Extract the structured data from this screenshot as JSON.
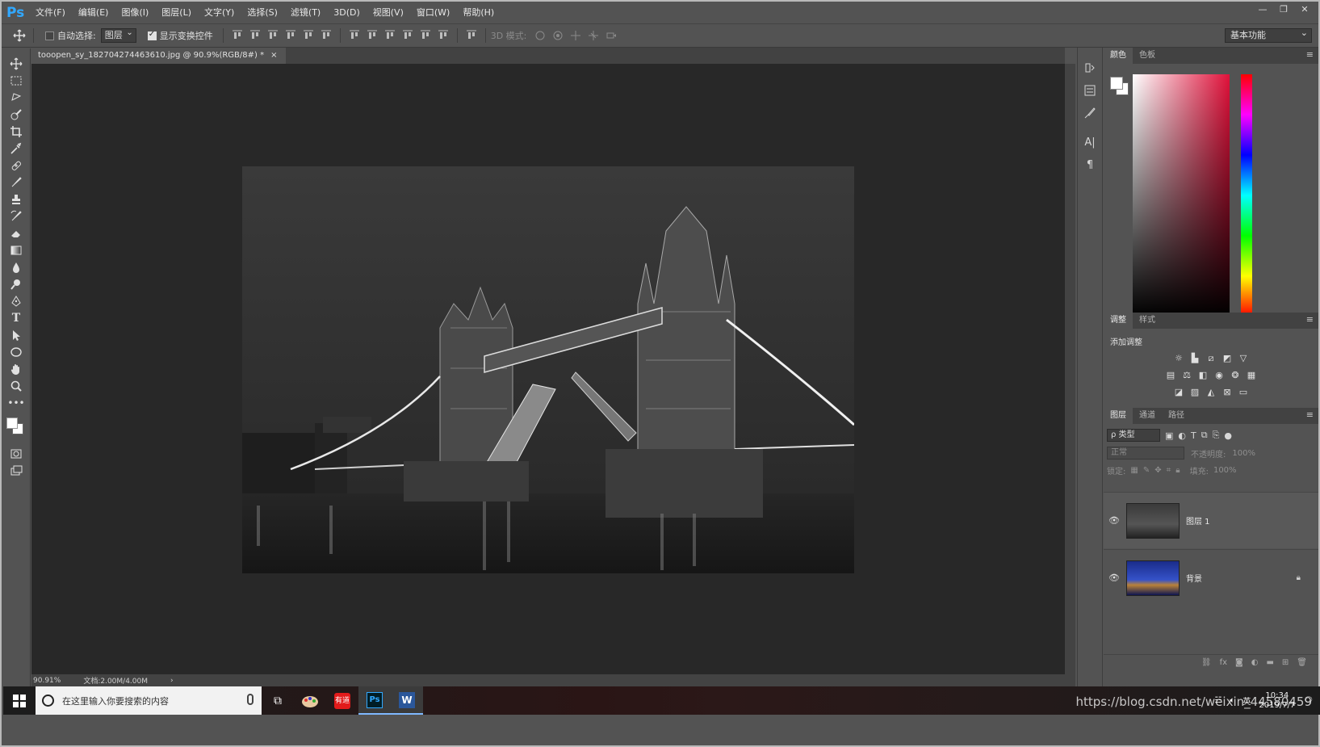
{
  "app": {
    "logo": "Ps"
  },
  "menu": [
    "文件(F)",
    "编辑(E)",
    "图像(I)",
    "图层(L)",
    "文字(Y)",
    "选择(S)",
    "滤镜(T)",
    "3D(D)",
    "视图(V)",
    "窗口(W)",
    "帮助(H)"
  ],
  "options": {
    "auto_select_label": "自动选择:",
    "auto_select_checked": false,
    "auto_select_target": "图层",
    "show_transform_label": "显示变换控件",
    "show_transform_checked": true,
    "mode_3d_label": "3D 模式:",
    "workspace": "基本功能"
  },
  "document": {
    "tab_title": "tooopen_sy_182704274463610.jpg @ 90.9%(RGB/8#) *",
    "close": "×",
    "zoom": "90.91%",
    "doc_info": "文档:2.00M/4.00M",
    "more": "›"
  },
  "panels": {
    "color": {
      "tabs": [
        "颜色",
        "色板"
      ],
      "active": 0
    },
    "adjust": {
      "tabs": [
        "调整",
        "样式"
      ],
      "active": 0,
      "heading": "添加调整"
    },
    "layers": {
      "tabs": [
        "图层",
        "通道",
        "路径"
      ],
      "active": 0,
      "filter": "ρ 类型",
      "blend_mode": "正常",
      "opacity_label": "不透明度:",
      "opacity_value": "100%",
      "lock_label": "锁定:",
      "fill_label": "填充:",
      "fill_value": "100%",
      "items": [
        {
          "name": "图层 1",
          "visible": true,
          "locked": false
        },
        {
          "name": "背景",
          "visible": true,
          "locked": true
        }
      ]
    }
  },
  "taskbar": {
    "search_placeholder": "在这里输入你要搜索的内容",
    "time": "10:34",
    "date": "2019/7/7",
    "watermark": "https://blog.csdn.net/weixin_44580459",
    "apps": [
      "task-view",
      "paint",
      "youdao",
      "photoshop",
      "word"
    ]
  }
}
